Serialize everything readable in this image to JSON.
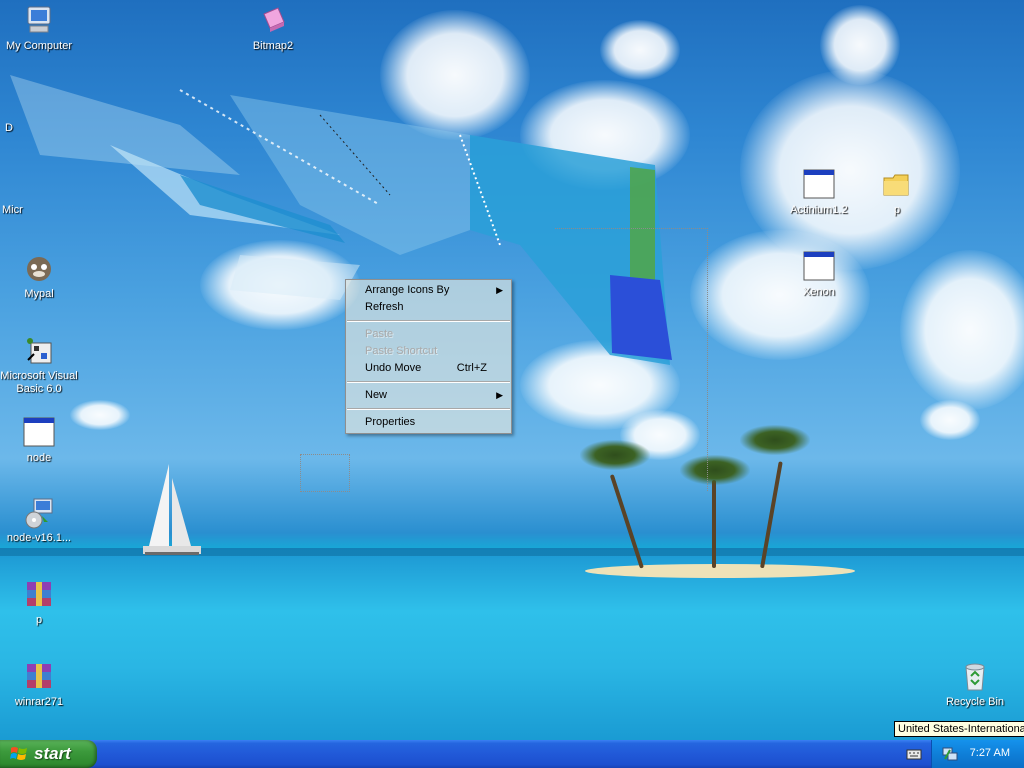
{
  "desktop": {
    "left_icons": [
      {
        "label": "My Computer",
        "icon": "my-computer-icon"
      },
      {
        "label": "Mypal",
        "icon": "mypal-icon"
      },
      {
        "label": "Microsoft Visual Basic 6.0",
        "icon": "visual-basic-icon"
      },
      {
        "label": "node",
        "icon": "application-window-icon"
      },
      {
        "label": "node-v16.1...",
        "icon": "installer-icon"
      },
      {
        "label": "p",
        "icon": "winrar-archive-icon"
      },
      {
        "label": "winrar271",
        "icon": "winrar-archive-icon"
      }
    ],
    "top_icons": [
      {
        "label": "Bitmap2",
        "icon": "bitmap-icon"
      }
    ],
    "right_icons": [
      {
        "label": "Actinium1.2",
        "icon": "application-window-icon"
      },
      {
        "label": "p",
        "icon": "folder-icon"
      },
      {
        "label": "Xenon",
        "icon": "application-window-icon"
      },
      {
        "label": "Recycle Bin",
        "icon": "recycle-bin-icon"
      }
    ],
    "fragments": {
      "d": "D",
      "micr": "Micr"
    }
  },
  "context_menu": {
    "items": [
      {
        "label": "Arrange Icons By",
        "enabled": true,
        "submenu": true
      },
      {
        "label": "Refresh",
        "enabled": true
      },
      {
        "label": "Paste",
        "enabled": false
      },
      {
        "label": "Paste Shortcut",
        "enabled": false
      },
      {
        "label": "Undo Move",
        "enabled": true,
        "shortcut": "Ctrl+Z"
      },
      {
        "label": "New",
        "enabled": true,
        "submenu": true
      },
      {
        "label": "Properties",
        "enabled": true
      }
    ],
    "submenu_arrow": "▶"
  },
  "taskbar": {
    "start_label": "start",
    "clock": "7:27 AM",
    "tooltip": "United States-International"
  },
  "colors": {
    "taskbar_blue": "#2159d8",
    "start_green": "#3c9a3c",
    "tray_blue": "#0f7fd8"
  }
}
